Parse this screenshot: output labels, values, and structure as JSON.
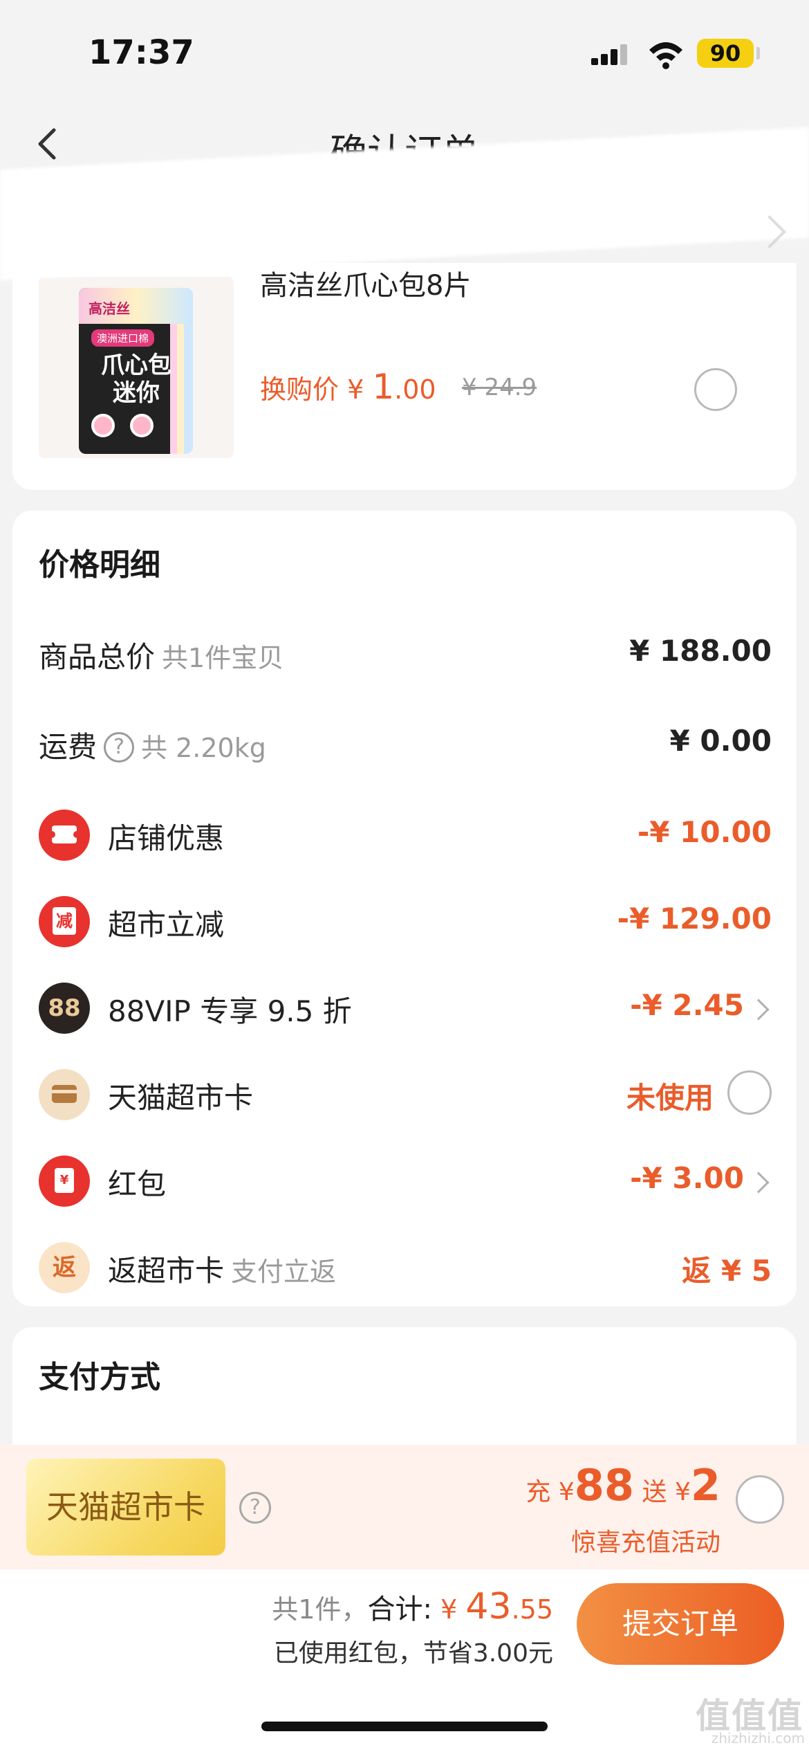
{
  "status_bar": {
    "time": "17:37",
    "battery": "90"
  },
  "nav": {
    "title": "确认订单"
  },
  "product": {
    "name": "高洁丝爪心包8片",
    "package_text": "爪心包迷你",
    "package_tag": "澳洲进口棉",
    "brand": "高洁丝",
    "swap_label": "换购价 ¥ ",
    "swap_price_int": "1",
    "swap_price_dec": ".00",
    "original_price": "¥ 24.9"
  },
  "price_detail": {
    "title": "价格明细",
    "rows": [
      {
        "label": "商品总价",
        "sub": "共1件宝贝",
        "value": "¥ 188.00"
      },
      {
        "label": "运费",
        "sub": "共 2.20kg",
        "value": "¥ 0.00"
      },
      {
        "label": "店铺优惠",
        "value": "-¥ 10.00",
        "icon": "coupon-icon"
      },
      {
        "label": "超市立减",
        "value": "-¥ 129.00",
        "icon": "reduce-icon",
        "icon_text": "减"
      },
      {
        "label": "88VIP 专享 9.5 折",
        "value": "-¥ 2.45",
        "icon": "vip88-icon",
        "icon_text": "88"
      },
      {
        "label": "天猫超市卡",
        "value": "未使用",
        "icon": "card-icon"
      },
      {
        "label": "红包",
        "value": "-¥ 3.00",
        "icon": "red-envelope-icon",
        "icon_text": "¥"
      },
      {
        "label": "返超市卡",
        "sub": "支付立返",
        "value": "返 ¥ 5",
        "icon": "return-icon",
        "icon_text": "返"
      }
    ]
  },
  "payment": {
    "title": "支付方式"
  },
  "promo": {
    "card_label": "天猫超市卡",
    "charge_label": "充 ¥",
    "charge_amount": "88",
    "gift_label": "送 ¥",
    "gift_amount": "2",
    "activity": "惊喜充值活动"
  },
  "bottom": {
    "count": "共1件，",
    "total_label": "合计:",
    "currency": "¥ ",
    "total_int": "43",
    "total_dec": ".55",
    "saving": "已使用红包，节省3.00元",
    "submit": "提交订单",
    "watermark": "值值值",
    "watermark_sub": "zhizhizhi.com"
  },
  "colors": {
    "accent": "#ea5c2a",
    "red": "#e8322e",
    "background": "#f3f3f3"
  }
}
